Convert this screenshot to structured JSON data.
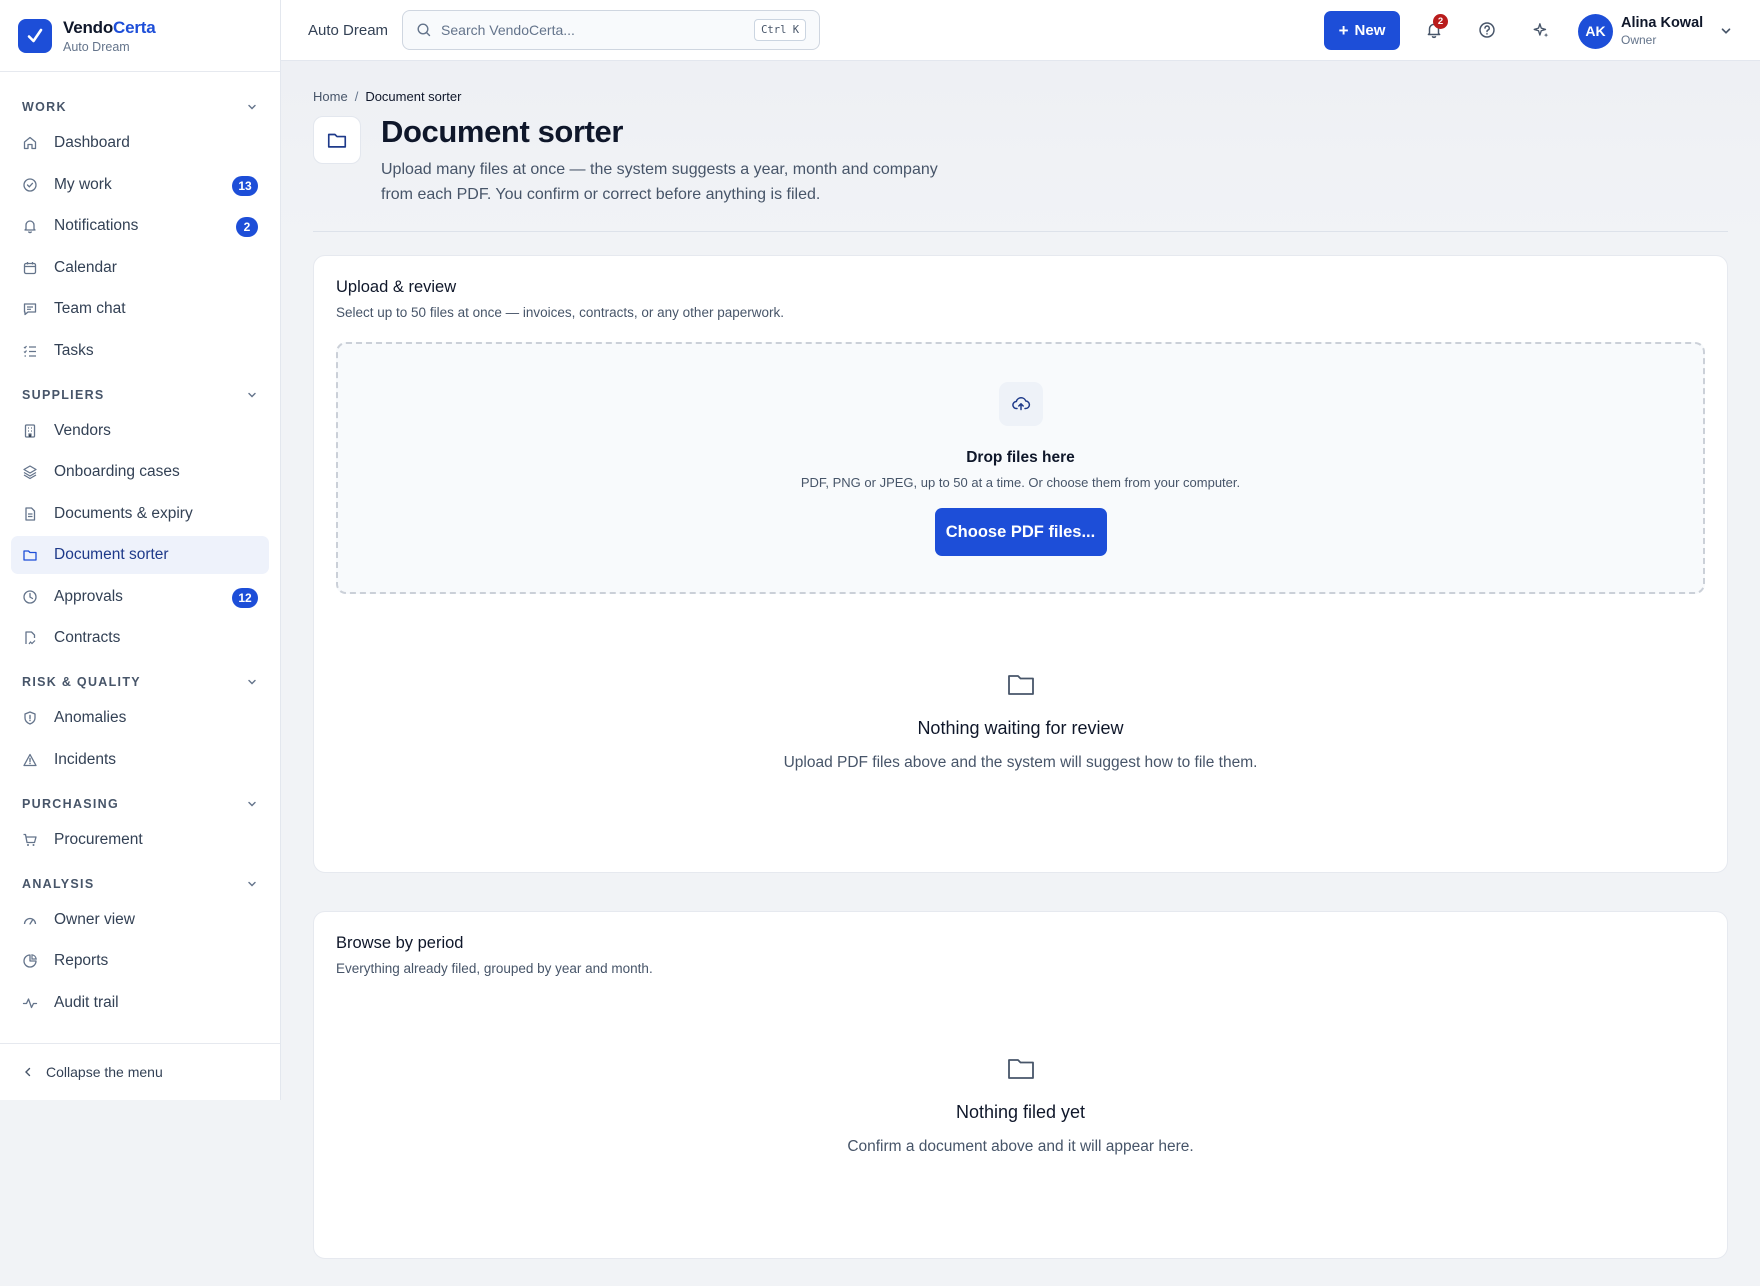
{
  "brand": {
    "name_part1": "Vendo",
    "name_part2": "Certa",
    "workspace": "Auto Dream"
  },
  "sidebar": {
    "sections": [
      {
        "label": "WORK",
        "items": [
          {
            "label": "Dashboard",
            "icon": "home-icon"
          },
          {
            "label": "My work",
            "icon": "check-circle-icon",
            "badge": "13"
          },
          {
            "label": "Notifications",
            "icon": "bell-icon",
            "badge": "2"
          },
          {
            "label": "Calendar",
            "icon": "calendar-icon"
          },
          {
            "label": "Team chat",
            "icon": "chat-icon"
          },
          {
            "label": "Tasks",
            "icon": "list-checks-icon"
          }
        ]
      },
      {
        "label": "SUPPLIERS",
        "items": [
          {
            "label": "Vendors",
            "icon": "building-icon"
          },
          {
            "label": "Onboarding cases",
            "icon": "layers-icon"
          },
          {
            "label": "Documents & expiry",
            "icon": "file-icon"
          },
          {
            "label": "Document sorter",
            "icon": "folder-icon",
            "active": true
          },
          {
            "label": "Approvals",
            "icon": "clock-icon",
            "badge": "12"
          },
          {
            "label": "Contracts",
            "icon": "file-signature-icon"
          }
        ]
      },
      {
        "label": "RISK & QUALITY",
        "items": [
          {
            "label": "Anomalies",
            "icon": "shield-alert-icon"
          },
          {
            "label": "Incidents",
            "icon": "warning-triangle-icon"
          }
        ]
      },
      {
        "label": "PURCHASING",
        "items": [
          {
            "label": "Procurement",
            "icon": "cart-icon"
          }
        ]
      },
      {
        "label": "ANALYSIS",
        "items": [
          {
            "label": "Owner view",
            "icon": "gauge-icon"
          },
          {
            "label": "Reports",
            "icon": "pie-chart-icon"
          },
          {
            "label": "Audit trail",
            "icon": "activity-icon"
          }
        ]
      }
    ],
    "collapse_label": "Collapse the menu"
  },
  "topbar": {
    "workspace": "Auto Dream",
    "search_placeholder": "Search VendoCerta...",
    "search_shortcut": "Ctrl K",
    "new_label": "New",
    "notifications_count": "2",
    "user": {
      "initials": "AK",
      "name": "Alina Kowal",
      "role": "Owner"
    }
  },
  "page": {
    "breadcrumb": {
      "home": "Home",
      "separator": "/",
      "current": "Document sorter"
    },
    "title": "Document sorter",
    "description": "Upload many files at once — the system suggests a year, month and company from each PDF. You confirm or correct before anything is filed."
  },
  "upload_card": {
    "title": "Upload & review",
    "subtitle": "Select up to 50 files at once — invoices, contracts, or any other paperwork.",
    "dropzone": {
      "title": "Drop files here",
      "subtitle": "PDF, PNG or JPEG, up to 50 at a time. Or choose them from your computer.",
      "button": "Choose PDF files..."
    },
    "empty": {
      "title": "Nothing waiting for review",
      "subtitle": "Upload PDF files above and the system will suggest how to file them."
    }
  },
  "browse_card": {
    "title": "Browse by period",
    "subtitle": "Everything already filed, grouped by year and month.",
    "empty": {
      "title": "Nothing filed yet",
      "subtitle": "Confirm a document above and it will appear here."
    }
  },
  "colors": {
    "accent": "#1d4ed8",
    "badge_alert": "#b91c1c",
    "active_bg": "#eef2fb"
  }
}
